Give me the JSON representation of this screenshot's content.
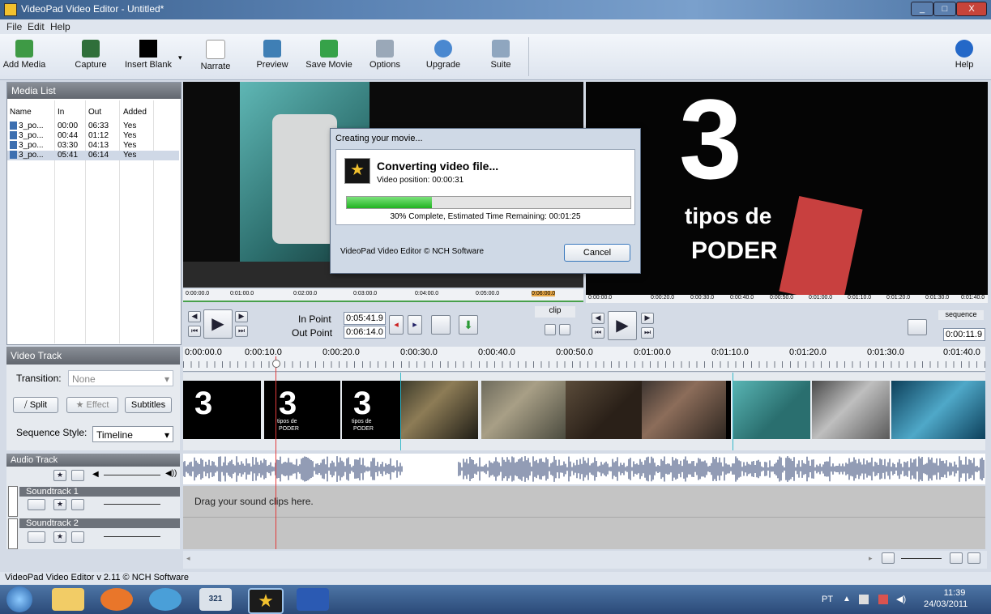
{
  "window": {
    "title": "VideoPad Video Editor - Untitled*",
    "min": "_",
    "max": "□",
    "close": "X"
  },
  "menu": [
    "File",
    "Edit",
    "Help"
  ],
  "toolbar": [
    "Add Media",
    "Capture",
    "Insert Blank",
    "Narrate",
    "Preview",
    "Save Movie",
    "Options",
    "Upgrade",
    "Suite"
  ],
  "help_label": "Help",
  "media_list": {
    "title": "Media List",
    "columns": [
      "Name",
      "In",
      "Out",
      "Added"
    ],
    "rows": [
      [
        "3_po...",
        "00:00",
        "06:33",
        "Yes"
      ],
      [
        "3_po...",
        "00:44",
        "01:12",
        "Yes"
      ],
      [
        "3_po...",
        "03:30",
        "04:13",
        "Yes"
      ],
      [
        "3_po...",
        "05:41",
        "06:14",
        "Yes"
      ]
    ]
  },
  "clip_preview": {
    "ticks": [
      "0:00:00.0",
      "0:01:00.0",
      "0:02:00.0",
      "0:03:00.0",
      "0:04:00.0",
      "0:05:00.0",
      "0:06:00.0"
    ],
    "in_label": "In Point",
    "in_value": "0:05:41.9",
    "out_label": "Out Point",
    "out_value": "0:06:14.0",
    "clip_tab": "clip"
  },
  "seq_preview": {
    "text_big": "3",
    "text_line1": "tipos de",
    "text_line2": "PODER",
    "ticks": [
      "0:00:00.0",
      "0:00:20.0",
      "0:00:30.0",
      "0:00:40.0",
      "0:00:50.0",
      "0:01:00.0",
      "0:01:10.0",
      "0:01:20.0",
      "0:01:30.0",
      "0:01:40.0"
    ],
    "seq_tab": "sequence",
    "time": "0:00:11.9"
  },
  "dialog": {
    "title": "Creating your movie...",
    "heading": "Converting video file...",
    "position": "Video position:  00:00:31",
    "progress": 0.3,
    "status": "30% Complete, Estimated Time Remaining: 00:01:25",
    "footer": "VideoPad Video Editor © NCH Software",
    "cancel": "Cancel"
  },
  "video_track": {
    "title": "Video Track",
    "transition_label": "Transition:",
    "transition_value": "None",
    "split": "Split",
    "effect": "Effect",
    "subtitles": "Subtitles",
    "sequence_style_label": "Sequence Style:",
    "sequence_style_value": "Timeline"
  },
  "timeline_ticks": [
    "0:00:00.0",
    "0:00:10.0",
    "0:00:20.0",
    "0:00:30.0",
    "0:00:40.0",
    "0:00:50.0",
    "0:01:00.0",
    "0:01:10.0",
    "0:01:20.0",
    "0:01:30.0",
    "0:01:40.0"
  ],
  "clip_text": {
    "big": "3",
    "small1": "tipos de",
    "small2": "PODER"
  },
  "audio": {
    "audio_track": "Audio Track",
    "soundtrack1": "Soundtrack 1",
    "soundtrack2": "Soundtrack 2",
    "drag_hint": "Drag your sound clips here."
  },
  "status": "VideoPad Video Editor v 2.11 © NCH Software",
  "taskbar": {
    "lang": "PT",
    "time": "11:39",
    "date": "24/03/2011",
    "calendar_day": "321"
  },
  "colors": {
    "progress": "#21b321",
    "accent": "#3a5f8c",
    "playhead": "#e23b3b"
  }
}
